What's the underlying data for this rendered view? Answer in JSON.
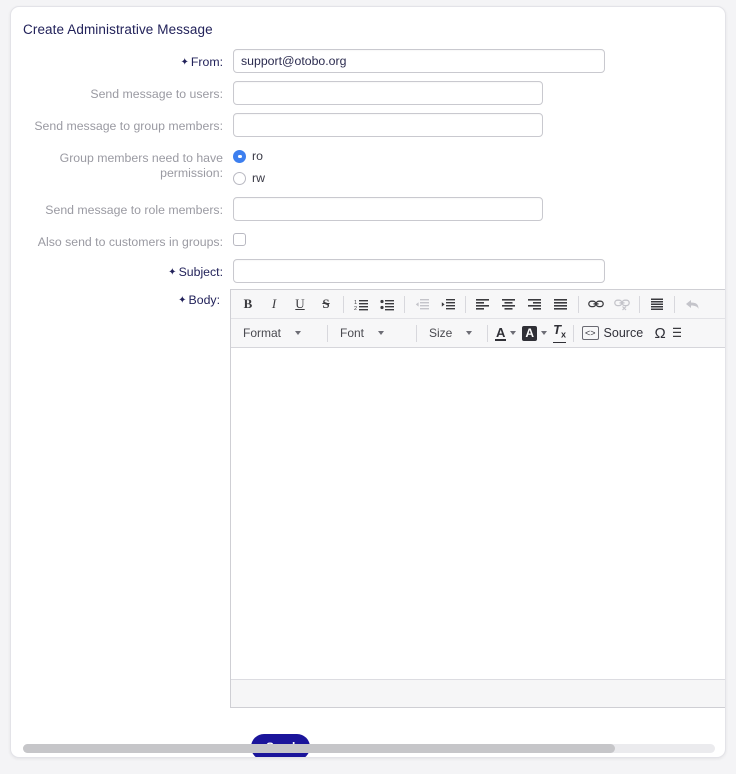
{
  "panel": {
    "title": "Create Administrative Message"
  },
  "form": {
    "from": {
      "label": "From:",
      "value": "support@otobo.org",
      "required": true
    },
    "send_to_users": {
      "label": "Send message to users:",
      "value": "",
      "required": false
    },
    "send_to_group_members": {
      "label": "Send message to group members:",
      "value": "",
      "required": false
    },
    "permission": {
      "label_line1": "Group members need to have",
      "label_line2": "permission:",
      "options": [
        {
          "label": "ro",
          "selected": true
        },
        {
          "label": "rw",
          "selected": false
        }
      ]
    },
    "send_to_role_members": {
      "label": "Send message to role members:",
      "value": "",
      "required": false
    },
    "also_send_customers": {
      "label": "Also send to customers in groups:",
      "checked": false
    },
    "subject": {
      "label": "Subject:",
      "value": "",
      "required": true
    },
    "body": {
      "label": "Body:",
      "value": "",
      "required": true
    }
  },
  "editor": {
    "toolbar_row1": [
      {
        "name": "bold-icon",
        "glyph": "B",
        "disabled": false
      },
      {
        "name": "italic-icon",
        "glyph": "I",
        "disabled": false
      },
      {
        "name": "underline-icon",
        "glyph": "U",
        "disabled": false
      },
      {
        "name": "strikethrough-icon",
        "glyph": "S",
        "disabled": false
      },
      {
        "name": "numbered-list-icon",
        "glyph": "",
        "disabled": false
      },
      {
        "name": "bulleted-list-icon",
        "glyph": "",
        "disabled": false
      },
      {
        "name": "decrease-indent-icon",
        "glyph": "",
        "disabled": true
      },
      {
        "name": "increase-indent-icon",
        "glyph": "",
        "disabled": false
      },
      {
        "name": "align-left-icon",
        "glyph": "",
        "disabled": false
      },
      {
        "name": "align-center-icon",
        "glyph": "",
        "disabled": false
      },
      {
        "name": "align-right-icon",
        "glyph": "",
        "disabled": false
      },
      {
        "name": "align-justify-icon",
        "glyph": "",
        "disabled": false
      },
      {
        "name": "link-icon",
        "glyph": "",
        "disabled": false
      },
      {
        "name": "unlink-icon",
        "glyph": "",
        "disabled": true
      },
      {
        "name": "blockquote-icon",
        "glyph": "",
        "disabled": false
      },
      {
        "name": "undo-icon",
        "glyph": "",
        "disabled": true
      }
    ],
    "format_dropdown": "Format",
    "font_dropdown": "Font",
    "size_dropdown": "Size",
    "text_color_glyph": "A",
    "background_color_glyph": "A",
    "remove_format_glyph": "T",
    "remove_format_sub": "x",
    "source_label": "Source",
    "special_char_glyph": "Ω",
    "content": ""
  },
  "actions": {
    "send_label": "Send"
  },
  "colors": {
    "title": "#22225a",
    "label_optional": "#9a9aa2",
    "label_required": "#22225a",
    "radio_selected": "#3d7fef",
    "send_button": "#1b159b",
    "page_background": "#f4f4f6"
  }
}
